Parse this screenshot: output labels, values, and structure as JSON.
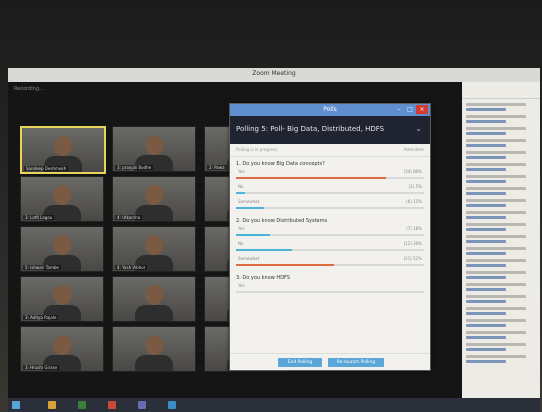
{
  "window": {
    "title": "Zoom Meeting",
    "recording": "Recording..."
  },
  "participants": [
    {
      "name": "Sandeep Deshmukh",
      "active": true
    },
    {
      "name": "3: pranjali Bodhe",
      "active": false
    },
    {
      "name": "2: Pawa",
      "active": false
    },
    {
      "name": "3: Lotfi Lagou",
      "active": false
    },
    {
      "name": "4: Utkarsha",
      "active": false
    },
    {
      "name": "",
      "active": false
    },
    {
      "name": "5: Ishwari Tambe",
      "active": false
    },
    {
      "name": "4: Yash Vibhor",
      "active": false
    },
    {
      "name": "",
      "active": false
    },
    {
      "name": "3: Aditya Rajale",
      "active": false
    },
    {
      "name": "",
      "active": false
    },
    {
      "name": "",
      "active": false
    },
    {
      "name": "3: Hrushi Girase",
      "active": false
    },
    {
      "name": "",
      "active": false
    },
    {
      "name": "",
      "active": false
    }
  ],
  "polls": {
    "window_title": "Polls",
    "poll_title": "Polling 5: Poll- Big Data, Distributed, HDFS",
    "status_left": "Polling is in progress",
    "status_right": "Attendees",
    "questions": [
      {
        "text": "1. Do you know Big Data concepts?",
        "options": [
          {
            "label": "Yes",
            "value": "(34) 80%",
            "pct": 80,
            "color": "#e06a44"
          },
          {
            "label": "No",
            "value": "(2) 5%",
            "pct": 5,
            "color": "#4bb3d8"
          },
          {
            "label": "Somewhat",
            "value": "(6) 15%",
            "pct": 15,
            "color": "#4bb3d8"
          }
        ]
      },
      {
        "text": "2. Do you know Distributed Systems",
        "options": [
          {
            "label": "Yes",
            "value": "(7) 18%",
            "pct": 18,
            "color": "#4bb3d8"
          },
          {
            "label": "No",
            "value": "(12) 30%",
            "pct": 30,
            "color": "#4bb3d8"
          },
          {
            "label": "Somewhat",
            "value": "(21) 52%",
            "pct": 52,
            "color": "#e06a44"
          }
        ]
      },
      {
        "text": "3. Do you know HDFS",
        "options": [
          {
            "label": "Yes",
            "value": "",
            "pct": 0,
            "color": "#4bb3d8"
          }
        ]
      }
    ],
    "end_button": "End Polling",
    "share_button": "Re-launch Polling"
  },
  "colors": {
    "accent": "#5aa6d8",
    "highlight": "#e06a44",
    "titlebar": "#5f8fcf",
    "close": "#d33b32"
  }
}
